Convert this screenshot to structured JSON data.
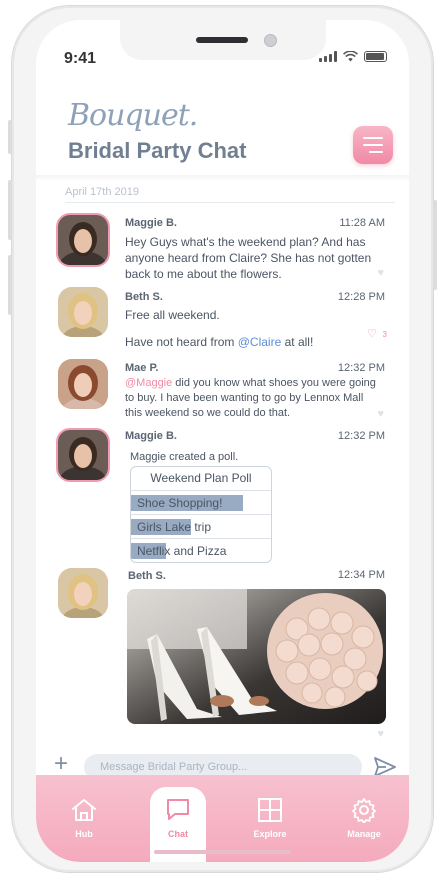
{
  "status_bar": {
    "time": "9:41"
  },
  "header": {
    "logo": "Bouquet.",
    "title": "Bridal Party Chat"
  },
  "date_divider": "April 17th 2019",
  "messages": [
    {
      "name": "Maggie B.",
      "time": "11:28 AM",
      "text": "Hey Guys what's the weekend plan? And has anyone heard from Claire? She has not gotten back to me about the flowers."
    },
    {
      "name": "Beth S.",
      "time": "12:28 PM",
      "text1": "Free all weekend.",
      "text2_pre": "Have not heard from ",
      "text2_mention": "@Claire",
      "text2_post": " at all!",
      "likes": "3"
    },
    {
      "name": "Mae P.",
      "time": "12:32 PM",
      "mention": "@Maggie",
      "text": " did you know what shoes you were going to buy. I have been wanting to go by Lennox Mall this weekend so we could do that."
    },
    {
      "name": "Maggie B.",
      "time": "12:32 PM",
      "text": "Maggie created a poll."
    },
    {
      "name": "Beth S.",
      "time": "12:34 PM"
    }
  ],
  "poll": {
    "title": "Weekend Plan Poll",
    "options": [
      {
        "label": "Shoe Shopping!",
        "fraction": 0.8
      },
      {
        "label": "Girls Lake trip",
        "fraction": 0.43
      },
      {
        "label": "Netflix and Pizza",
        "fraction": 0.25
      }
    ]
  },
  "compose": {
    "placeholder": "Message Bridal Party Group..."
  },
  "tabs": [
    {
      "label": "Hub",
      "icon": "home-icon"
    },
    {
      "label": "Chat",
      "icon": "chat-icon",
      "active": true
    },
    {
      "label": "Explore",
      "icon": "grid-icon"
    },
    {
      "label": "Manage",
      "icon": "gear-icon"
    }
  ],
  "colors": {
    "accent": "#f08aa5",
    "slate": "#717f92",
    "poll_bar": "#98abc3",
    "mention_blue": "#5b8fd6"
  }
}
